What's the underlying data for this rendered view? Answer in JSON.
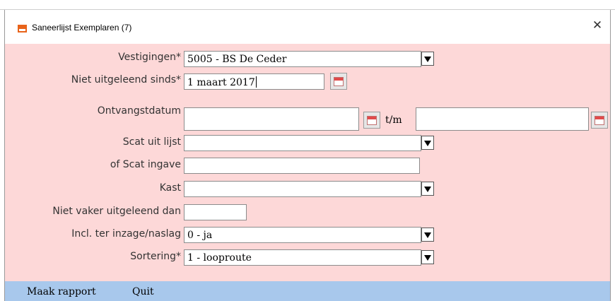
{
  "window": {
    "title": "Saneerlijst Exemplaren (7)",
    "close_label": "✕"
  },
  "form": {
    "vestigingen": {
      "label": "Vestigingen*",
      "value": "5005 - BS De Ceder"
    },
    "niet_uitgeleend_sinds": {
      "label": "Niet uitgeleend sinds*",
      "value": "1 maart 2017"
    },
    "ontvangstdatum": {
      "label": "Ontvangstdatum",
      "from_value": "",
      "separator": "t/m",
      "to_value": ""
    },
    "scat_uit_lijst": {
      "label": "Scat uit lijst",
      "value": ""
    },
    "scat_ingave": {
      "label": "of Scat ingave",
      "value": ""
    },
    "kast": {
      "label": "Kast",
      "value": ""
    },
    "niet_vaker_uitgeleend": {
      "label": "Niet vaker uitgeleend dan",
      "value": ""
    },
    "incl_ter_inzage": {
      "label": "Incl. ter inzage/naslag",
      "value": "0 - ja"
    },
    "sortering": {
      "label": "Sortering*",
      "value": "1 - looproute"
    }
  },
  "actions": {
    "make_report": "Maak rapport",
    "quit": "Quit"
  },
  "colors": {
    "form_background": "#fdd8d8",
    "action_bar": "#a8c8ec",
    "app_icon": "#e8631a"
  }
}
